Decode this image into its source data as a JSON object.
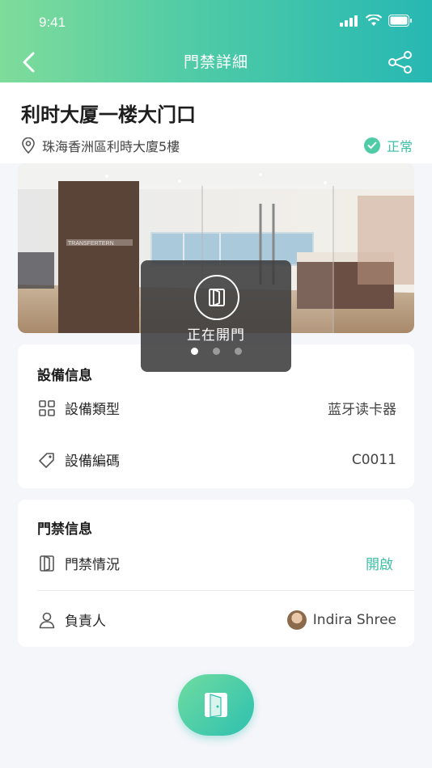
{
  "status_bar": {
    "time": "9:41"
  },
  "nav": {
    "title": "門禁詳細"
  },
  "door": {
    "title": "利时大厦一楼大门口",
    "location": "珠海香洲區利時大廈5樓",
    "status": "正常"
  },
  "photo": {
    "sign_text": "TRANSFERTERN"
  },
  "toast": {
    "text": "正在開門",
    "dots": 3,
    "active_dot": 0
  },
  "device_info": {
    "title": "設備信息",
    "rows": [
      {
        "icon": "grid-icon",
        "label": "設備類型",
        "value": "蓝牙读卡器"
      },
      {
        "icon": "tag-icon",
        "label": "設備編碼",
        "value": "C0011"
      }
    ]
  },
  "access_info": {
    "title": "門禁信息",
    "rows": [
      {
        "icon": "door-icon",
        "label": "門禁情況",
        "value": "開啟"
      },
      {
        "icon": "person-icon",
        "label": "負責人",
        "value": "Indira Shree"
      }
    ]
  },
  "colors": {
    "accent": "#3dbfa6",
    "header_start": "#7fdc9a",
    "header_end": "#27b8b3"
  }
}
